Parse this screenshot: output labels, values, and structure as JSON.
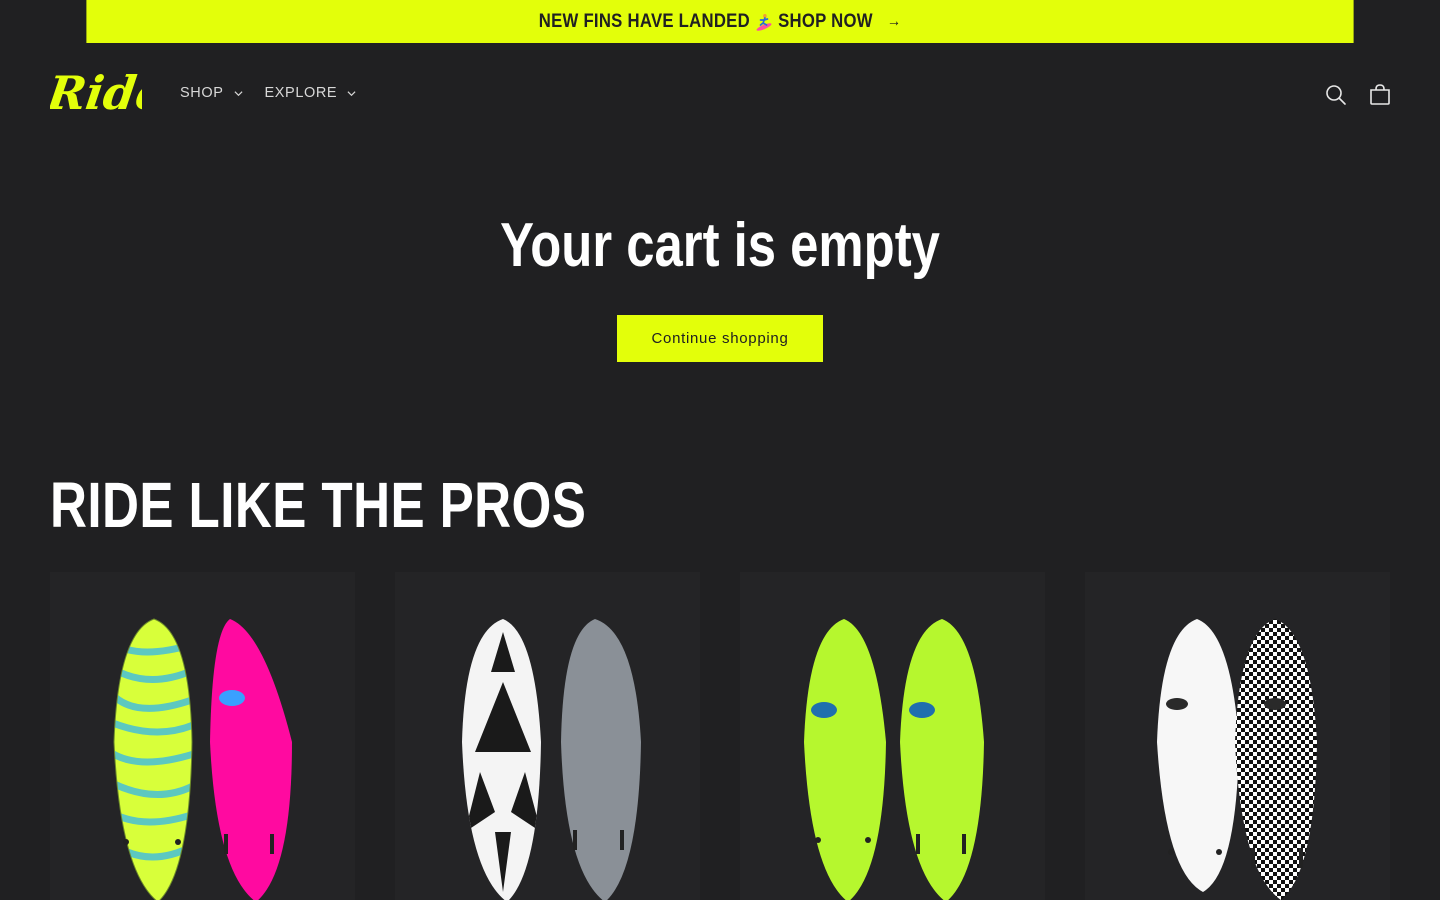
{
  "announcement": {
    "text_before": "NEW FINS HAVE LANDED",
    "text_after": "SHOP NOW",
    "surfer_icon": "surfer-icon",
    "arrow_icon": "arrow-right-icon"
  },
  "header": {
    "logo_text": "Ride",
    "nav": [
      {
        "label": "SHOP"
      },
      {
        "label": "EXPLORE"
      }
    ],
    "search_icon": "search-icon",
    "cart_icon": "cart-icon"
  },
  "cart": {
    "title": "Your cart is empty",
    "continue_label": "Continue shopping"
  },
  "featured": {
    "title": "RIDE LIKE THE PROS",
    "products": [
      {
        "image": "surfboard-pair-psychedelic-pink"
      },
      {
        "image": "surfboard-pair-black-white-grey"
      },
      {
        "image": "surfboard-pair-lime-flash"
      },
      {
        "image": "surfboard-pair-white-checker"
      }
    ]
  },
  "colors": {
    "accent": "#e3ff0a",
    "background": "#202022",
    "text": "#ffffff"
  }
}
